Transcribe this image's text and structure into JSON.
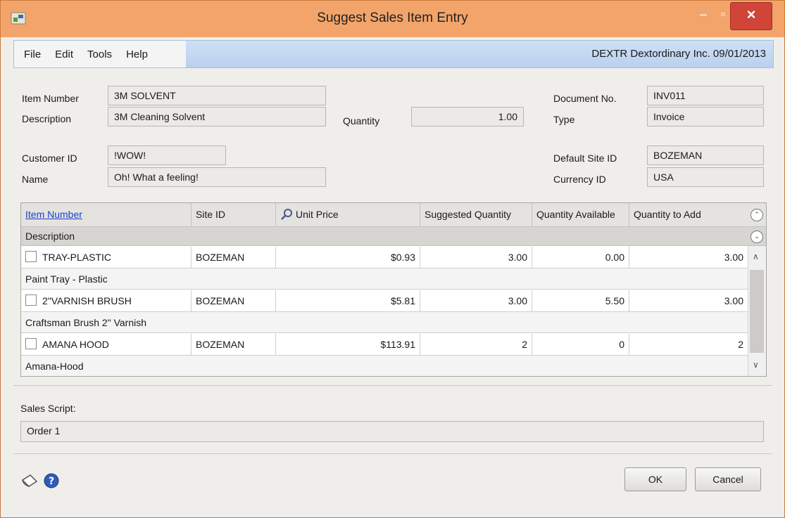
{
  "window": {
    "title": "Suggest Sales Item Entry"
  },
  "menu": {
    "items": [
      "File",
      "Edit",
      "Tools",
      "Help"
    ],
    "company": "DEXTR  Dextordinary Inc.  09/01/2013"
  },
  "header": {
    "item_number_label": "Item Number",
    "item_number": "3M SOLVENT",
    "description_label": "Description",
    "description": "3M Cleaning Solvent",
    "quantity_label": "Quantity",
    "quantity": "1.00",
    "document_no_label": "Document No.",
    "document_no": "INV011",
    "type_label": "Type",
    "type": "Invoice",
    "customer_id_label": "Customer ID",
    "customer_id": "!WOW!",
    "name_label": "Name",
    "name": "Oh! What a feeling!",
    "default_site_label": "Default Site ID",
    "default_site": "BOZEMAN",
    "currency_label": "Currency ID",
    "currency": "USA"
  },
  "grid": {
    "columns": [
      "Item Number",
      "Site ID",
      "Unit Price",
      "Suggested Quantity",
      "Quantity Available",
      "Quantity to Add"
    ],
    "subheader": "Description",
    "rows": [
      {
        "item": "TRAY-PLASTIC",
        "site": "BOZEMAN",
        "price": "$0.93",
        "suggested": "3.00",
        "available": "0.00",
        "add": "3.00",
        "description": "Paint Tray - Plastic",
        "checked": false
      },
      {
        "item": "2\"VARNISH BRUSH",
        "site": "BOZEMAN",
        "price": "$5.81",
        "suggested": "3.00",
        "available": "5.50",
        "add": "3.00",
        "description": "Craftsman Brush 2\" Varnish",
        "checked": false
      },
      {
        "item": "AMANA HOOD",
        "site": "BOZEMAN",
        "price": "$113.91",
        "suggested": "2",
        "available": "0",
        "add": "2",
        "description": "Amana-Hood",
        "checked": false
      }
    ]
  },
  "footer": {
    "sales_script_label": "Sales Script:",
    "sales_script": "Order 1",
    "ok_label": "OK",
    "cancel_label": "Cancel"
  },
  "colors": {
    "titlebar": "#f3a46a",
    "close_button": "#d0443a",
    "menubar": "#c4d8f2",
    "link": "#1a3fd0"
  }
}
